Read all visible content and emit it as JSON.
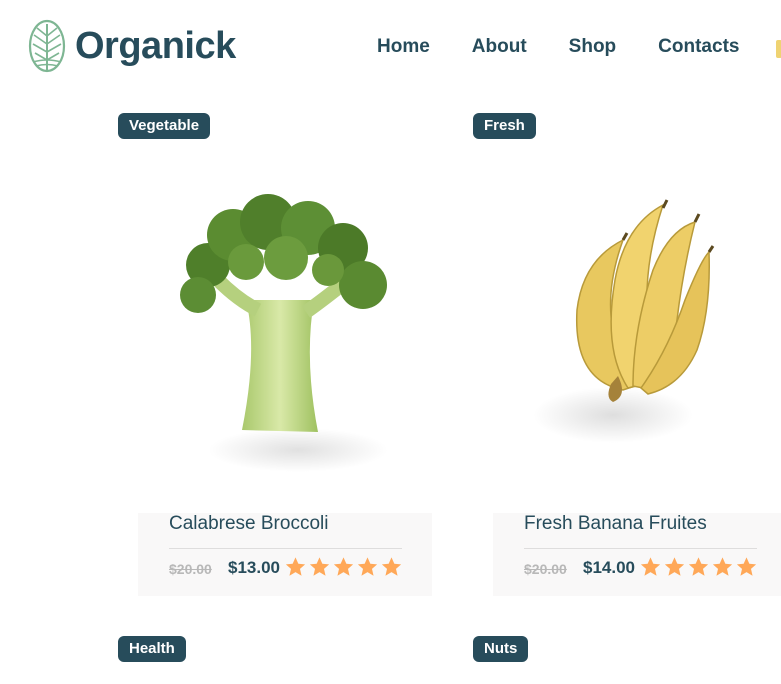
{
  "brand": {
    "name": "Organick"
  },
  "nav": {
    "home": "Home",
    "about": "About",
    "shop": "Shop",
    "contacts": "Contacts"
  },
  "colors": {
    "primary": "#274c5b",
    "star": "#ffa858",
    "panel_bg": "#f9f8f8",
    "logo_green": "#7eb693"
  },
  "products": [
    {
      "category": "Vegetable",
      "name": "Calabrese Broccoli",
      "old_price": "$20.00",
      "price": "$13.00",
      "rating": 5,
      "image_icon": "broccoli-image"
    },
    {
      "category": "Fresh",
      "name": "Fresh Banana Fruites",
      "old_price": "$20.00",
      "price": "$14.00",
      "rating": 5,
      "image_icon": "banana-image"
    }
  ],
  "next_row": [
    {
      "category": "Health"
    },
    {
      "category": "Nuts"
    }
  ]
}
